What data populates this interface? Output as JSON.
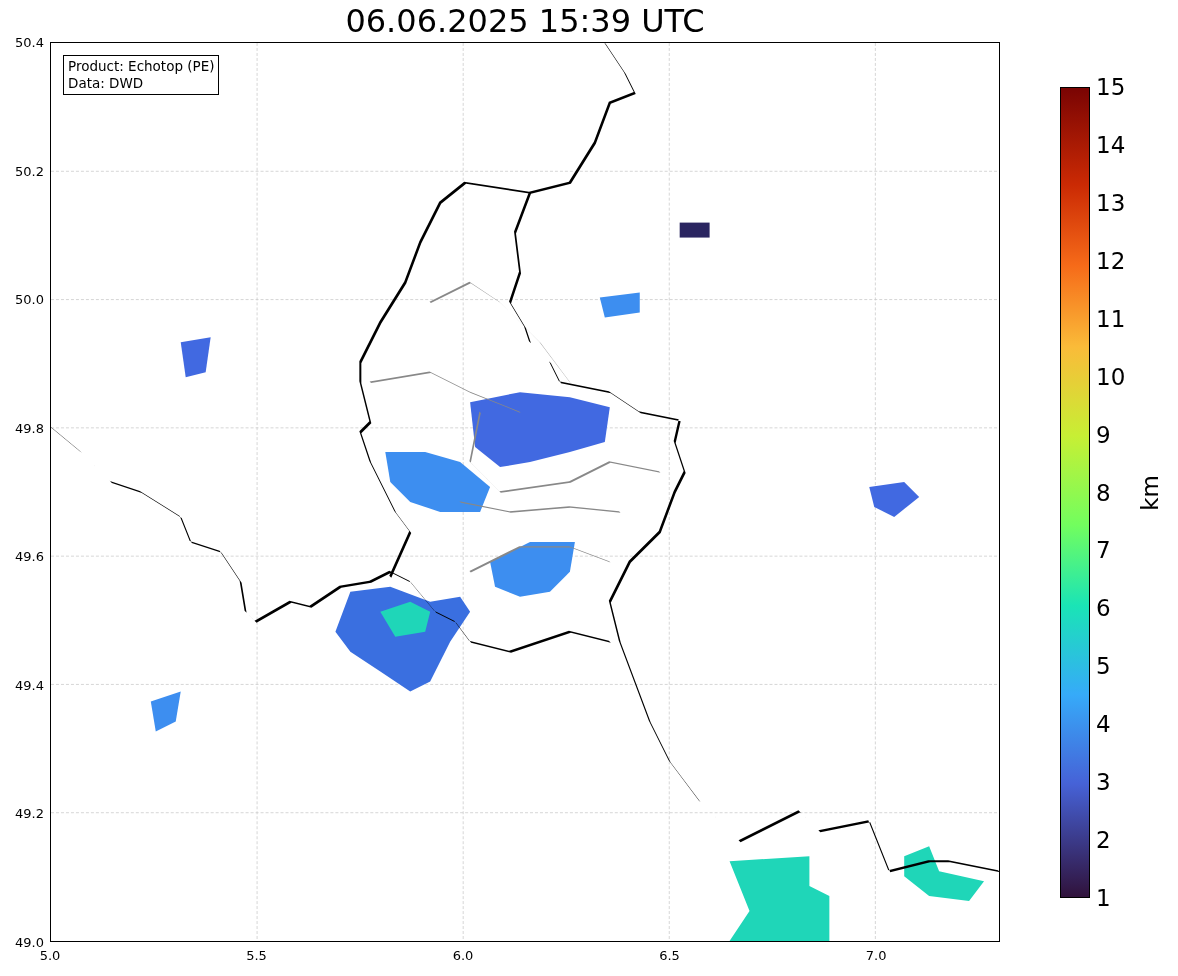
{
  "title": "06.06.2025 15:39 UTC",
  "legend": {
    "lines": [
      "Product: Echotop (PE)",
      "Data: DWD"
    ]
  },
  "x_axis": {
    "ticks": [
      "5.0",
      "5.5",
      "6.0",
      "6.5",
      "7.0"
    ]
  },
  "y_axis": {
    "ticks": [
      "50.4",
      "50.2",
      "50.0",
      "49.8",
      "49.6",
      "49.4",
      "49.2",
      "49.0"
    ]
  },
  "colorbar": {
    "label": "km",
    "ticks": [
      "15",
      "14",
      "13",
      "12",
      "11",
      "10",
      "9",
      "8",
      "7",
      "6",
      "5",
      "4",
      "3",
      "2",
      "1"
    ]
  }
}
